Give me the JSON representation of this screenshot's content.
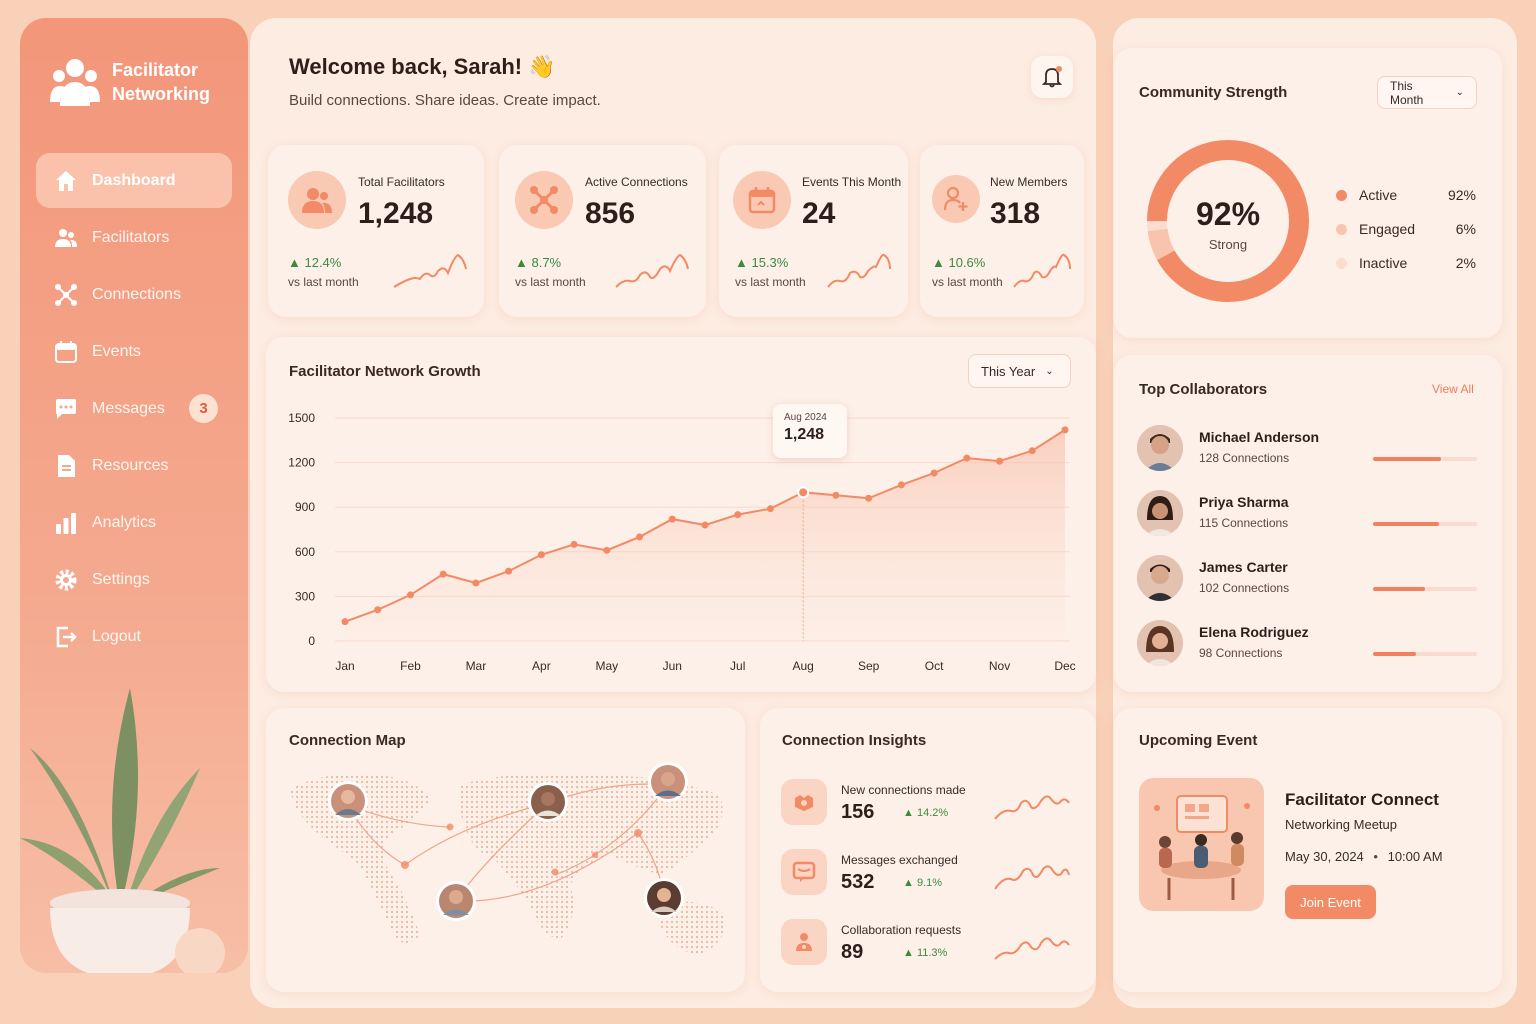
{
  "sidebar": {
    "logo_text": "Facilitator Networking",
    "items": [
      {
        "label": "Dashboard",
        "icon": "home-icon"
      },
      {
        "label": "Facilitators",
        "icon": "users-icon"
      },
      {
        "label": "Connections",
        "icon": "network-icon"
      },
      {
        "label": "Events",
        "icon": "calendar-icon"
      },
      {
        "label": "Messages",
        "icon": "chat-icon",
        "badge": "3"
      },
      {
        "label": "Resources",
        "icon": "document-icon"
      },
      {
        "label": "Analytics",
        "icon": "bar-chart-icon"
      },
      {
        "label": "Settings",
        "icon": "gear-icon"
      },
      {
        "label": "Logout",
        "icon": "logout-icon"
      }
    ]
  },
  "header": {
    "welcome": "Welcome back, Sarah! 👋",
    "subtitle": "Build connections. Share ideas. Create impact."
  },
  "stats": [
    {
      "label": "Total Facilitators",
      "value": "1,248",
      "change": "12.4%",
      "vs": "vs last month"
    },
    {
      "label": "Active Connections",
      "value": "856",
      "change": "8.7%",
      "vs": "vs last month"
    },
    {
      "label": "Events This Month",
      "value": "24",
      "change": "15.3%",
      "vs": "vs last month"
    },
    {
      "label": "New Members",
      "value": "318",
      "change": "10.6%",
      "vs": "vs last month"
    }
  ],
  "growth": {
    "title": "Facilitator Network Growth",
    "period": "This Year",
    "tooltip_date": "Aug 2024",
    "tooltip_value": "1,248"
  },
  "chart_data": {
    "type": "line",
    "x_ticks": [
      "Jan",
      "Feb",
      "Mar",
      "Apr",
      "May",
      "Jun",
      "Jul",
      "Aug",
      "Sep",
      "Oct",
      "Nov",
      "Dec"
    ],
    "y_ticks": [
      "1500",
      "1200",
      "900",
      "600",
      "300",
      "0"
    ],
    "ylim": [
      0,
      1500
    ],
    "values": [
      130,
      210,
      310,
      450,
      390,
      470,
      580,
      650,
      610,
      700,
      820,
      780,
      850,
      890,
      1000,
      980,
      960,
      1050,
      1130,
      1230,
      1210,
      1280,
      1420
    ],
    "highlight_index": 14
  },
  "community": {
    "title": "Community Strength",
    "period": "This Month",
    "center_value": "92%",
    "center_label": "Strong",
    "legend": [
      {
        "label": "Active",
        "pct": "92%",
        "fraction": 0.92,
        "color": "#f28a66"
      },
      {
        "label": "Engaged",
        "pct": "6%",
        "fraction": 0.06,
        "color": "#f9c4ad"
      },
      {
        "label": "Inactive",
        "pct": "2%",
        "fraction": 0.02,
        "color": "#fcdccd"
      }
    ]
  },
  "collaborators": {
    "title": "Top Collaborators",
    "view_all": "View All",
    "items": [
      {
        "name": "Michael Anderson",
        "connections": "128 Connections",
        "level": 0.65
      },
      {
        "name": "Priya Sharma",
        "connections": "115 Connections",
        "level": 0.63
      },
      {
        "name": "James Carter",
        "connections": "102 Connections",
        "level": 0.5
      },
      {
        "name": "Elena Rodriguez",
        "connections": "98 Connections",
        "level": 0.41
      }
    ]
  },
  "map": {
    "title": "Connection Map"
  },
  "insights": {
    "title": "Connection Insights",
    "items": [
      {
        "label": "New connections made",
        "value": "156",
        "change": "14.2%"
      },
      {
        "label": "Messages exchanged",
        "value": "532",
        "change": "9.1%"
      },
      {
        "label": "Collaboration requests",
        "value": "89",
        "change": "11.3%"
      }
    ]
  },
  "event": {
    "title": "Upcoming Event",
    "name": "Facilitator Connect",
    "subtitle": "Networking Meetup",
    "date": "May 30, 2024",
    "time": "10:00 AM",
    "button": "Join Event"
  }
}
